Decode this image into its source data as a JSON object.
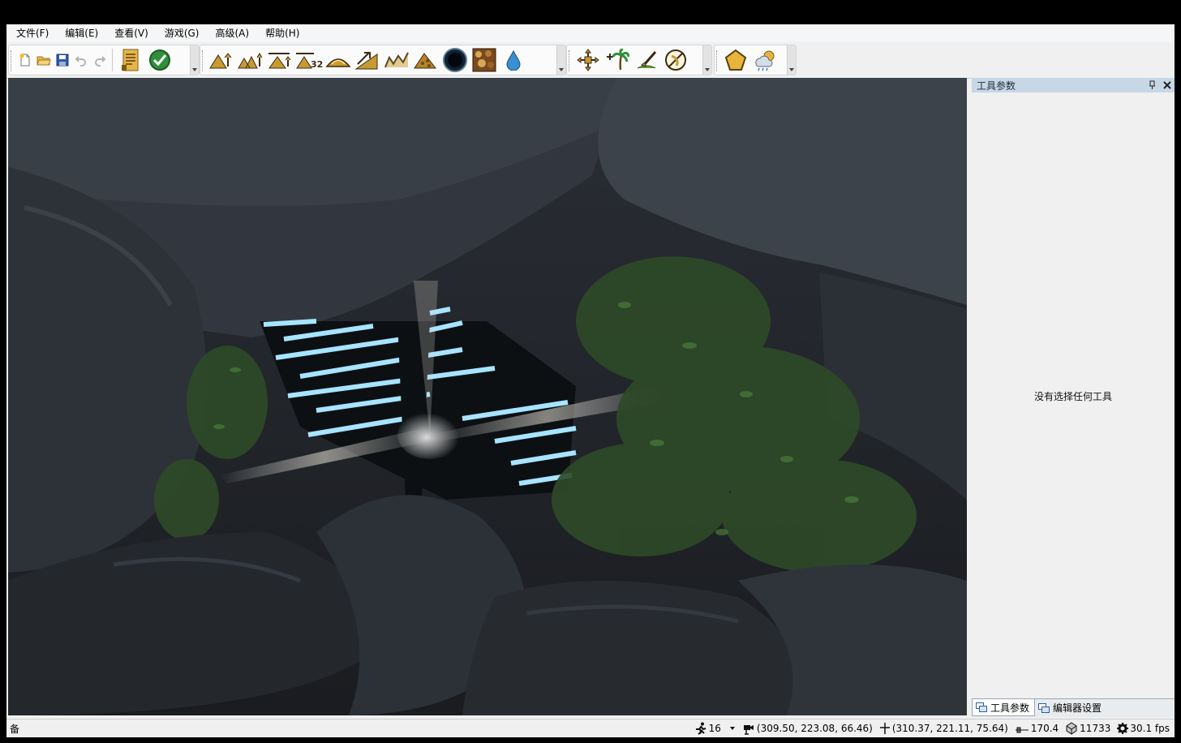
{
  "menu": [
    "文件(F)",
    "编辑(E)",
    "查看(V)",
    "游戏(G)",
    "高级(A)",
    "帮助(H)"
  ],
  "toolbar": {
    "file": [
      "new-file-icon",
      "open-folder-icon",
      "save-icon",
      "undo-icon",
      "redo-icon"
    ],
    "editor": [
      "notes-icon",
      "validate-icon"
    ],
    "terrain": [
      "raise-terrain-icon",
      "raise-terrain-multi-icon",
      "flatten-terrain-icon",
      "terrain-32-icon",
      "smooth-hill-icon",
      "ramp-icon",
      "height-noise-icon",
      "rock-pile-icon",
      "hole-icon",
      "texture-paint-icon",
      "water-drop-icon"
    ],
    "objects": [
      "object-move-icon",
      "vegetation-icon",
      "brush-paint-icon",
      "road-tool-icon"
    ],
    "environment": [
      "area-shape-icon",
      "weather-icon"
    ],
    "number_badge": "32"
  },
  "panel": {
    "title": "工具参数",
    "pin_icon": "pin-icon",
    "close_icon": "close-icon",
    "empty_message": "没有选择任何工具",
    "tabs": [
      "工具参数",
      "编辑器设置"
    ]
  },
  "status": {
    "text": "备",
    "speed": "16",
    "camera_position": "(309.50, 223.08, 66.46)",
    "cursor_position": "(310.37, 221.11, 75.64)",
    "view_distance": "170.4",
    "draw_count": "11733",
    "fps": "30.1 fps"
  },
  "colors": {
    "panel_header": "#c8d7e6",
    "chrome": "#f0f0f0",
    "icon_gold": "#c99a32",
    "viewport_light": "#a7e4ff"
  }
}
